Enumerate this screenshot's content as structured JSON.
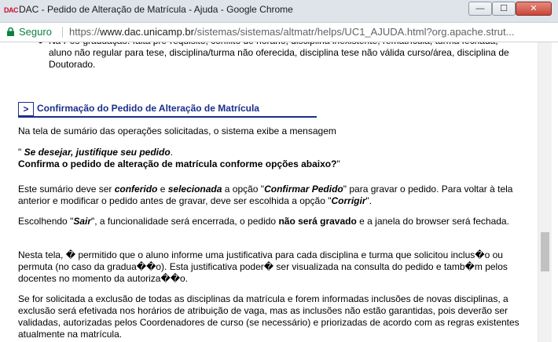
{
  "window": {
    "title": "DAC - Pedido de Alteração de Matrícula - Ajuda - Google Chrome",
    "app_icon_text": "DAC",
    "min_glyph": "—",
    "max_glyph": "☐",
    "close_glyph": "✕"
  },
  "address_bar": {
    "secure_label": "Seguro",
    "url_scheme": "https://",
    "url_host": "www.dac.unicamp.br",
    "url_path": "/sistemas/sistemas/altmatr/helps/UC1_AJUDA.html?org.apache.strut..."
  },
  "content": {
    "bullet_text": "Na Pós-graduação: falta pré-requisito, conflito de horário, disciplina inexistente, rematrícula, turma fechada, aluno não regular para tese, disciplina/turma não oferecida, disciplina tese não válida curso/área, disciplina de Doutorado.",
    "section_marker": ">",
    "section_title": "Confirmação do Pedido de Alteração de Matrícula",
    "p1": "Na tela de sumário das operações solicitadas, o sistema exibe a mensagem",
    "quote_open": "\" ",
    "quote_italic": "Se desejar, justifique seu pedido",
    "quote_dot": ".",
    "quote_line2": "Confirma o pedido de alteração de matrícula conforme opções abaixo?",
    "quote_close": "\"",
    "p3": {
      "a": "Este sumário deve ser ",
      "b": "conferido",
      "c": " e ",
      "d": "selecionada",
      "e": " a opção \"",
      "f": "Confirmar Pedido",
      "g": "\" para gravar o pedido. Para voltar à tela anterior e modificar o pedido antes de gravar, deve ser escolhida a opção \"",
      "h": "Corrigir",
      "i": "\"."
    },
    "p4": {
      "a": "Escolhendo \"",
      "b": "Sair",
      "c": "\", a funcionalidade será encerrada, o pedido ",
      "d": "não será gravado",
      "e": " e a janela do browser será fechada."
    },
    "p5": "Nesta tela, � permitido que o aluno informe uma justificativa para cada disciplina e turma que solicitou inclus�o ou permuta (no caso da gradua��o). Esta justificativa poder� ser visualizada na consulta do pedido e tamb�m pelos docentes no momento da autoriza��o.",
    "p6": "Se for solicitada a exclusão de todas as disciplinas da matrícula e forem informadas inclusões de novas disciplinas, a exclusão será efetivada nos horários de atribuição de vaga, mas as inclusões não estão garantidas, pois deverão ser validadas, autorizadas pelos Coordenadores de curso (se necessário) e priorizadas de acordo com as regras existentes atualmente na matrícula."
  }
}
